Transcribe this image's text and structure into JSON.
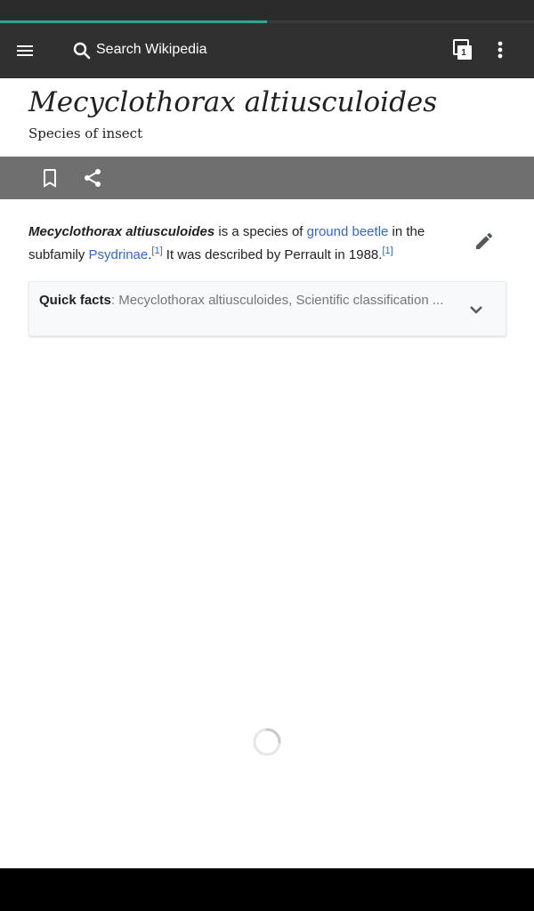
{
  "browser": {
    "load_progress": 0.5
  },
  "toolbar": {
    "menu_icon": "hamburger-menu-icon",
    "search_placeholder": "Search Wikipedia",
    "tabs_count": "1",
    "overflow_icon": "more-vert-icon"
  },
  "article": {
    "title": "Mecyclothorax altiusculoides",
    "description": "Species of insect",
    "actions": {
      "bookmark_icon": "bookmark-icon",
      "share_icon": "share-icon"
    },
    "intro": {
      "name": "Mecyclothorax altiusculoides",
      "text1": " is a species of ",
      "link1": "ground beetle",
      "text2": " in the subfamily ",
      "link2": "Psydrinae",
      "text3": ".",
      "ref1": "[1]",
      "text4": " It was described by Perrault in 1988.",
      "ref2": "[1]"
    },
    "quick_facts": {
      "label": "Quick facts",
      "summary": ": Mecyclothorax altiusculoides, Scientific classification ..."
    }
  },
  "colors": {
    "accent_progress": "#34a38f",
    "link": "#3366cc",
    "toolbar": "#303030",
    "action_bar": "#6f6f6f"
  }
}
